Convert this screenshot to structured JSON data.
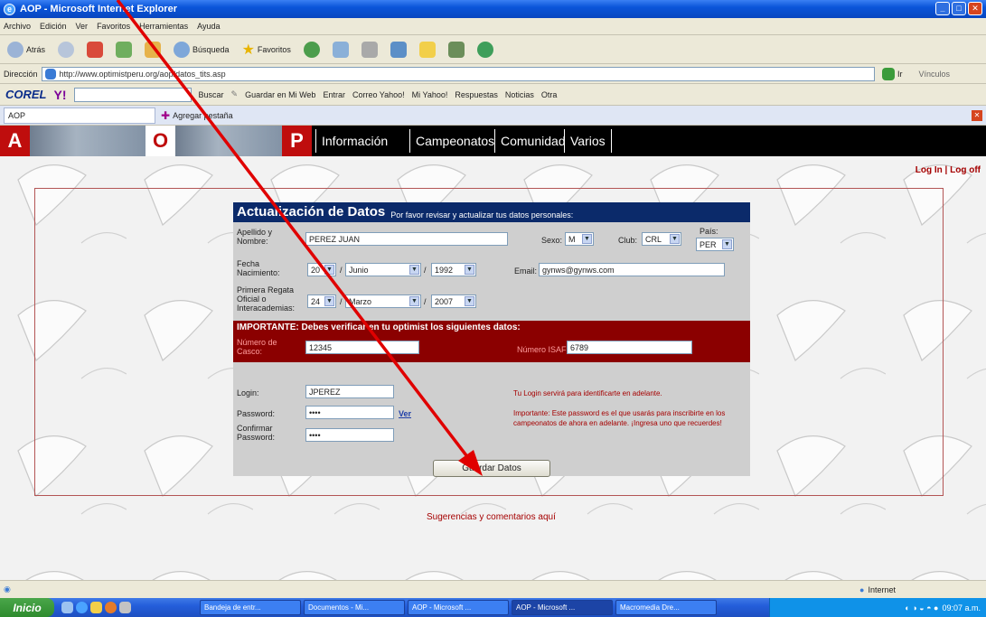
{
  "window": {
    "title": "AOP - Microsoft Internet Explorer"
  },
  "menu": [
    "Archivo",
    "Edición",
    "Ver",
    "Favoritos",
    "Herramientas",
    "Ayuda"
  ],
  "toolbar": {
    "back": "Atrás",
    "search": "Búsqueda",
    "favorites": "Favoritos"
  },
  "address": {
    "label": "Dirección",
    "url": "http://www.optimistperu.org/aop/datos_tits.asp",
    "go": "Ir",
    "links": "Vínculos"
  },
  "corel": {
    "brand": "COREL",
    "yahoo": "Y!",
    "search_btn": "Buscar",
    "save_web": "Guardar en Mi Web",
    "enter": "Entrar",
    "mail": "Correo Yahoo!",
    "myyahoo": "Mi Yahoo!",
    "answers": "Respuestas",
    "news": "Noticias",
    "more": "Otra"
  },
  "tabs": {
    "current": "AOP",
    "new_tab": "Agregar pestaña"
  },
  "site": {
    "logo": [
      "A",
      "O",
      "P"
    ],
    "nav": [
      "Información",
      "Campeonatos",
      "Comunidad",
      "Varios"
    ],
    "login": "Log In | Log off"
  },
  "form": {
    "title": "Actualización de Datos",
    "subtitle": "Por favor revisar y actualizar tus datos personales:",
    "labels": {
      "name": "Apellido y Nombre:",
      "sex": "Sexo:",
      "club": "Club:",
      "country": "País:",
      "birth": "Fecha Nacimiento:",
      "email": "Email:",
      "first_regatta": "Primera Regata Oficial o Interacademias:",
      "hull": "Número de Casco:",
      "isaf": "Número ISAF:",
      "login": "Login:",
      "password": "Password:",
      "confirm": "Confirmar Password:"
    },
    "values": {
      "name": "PEREZ JUAN",
      "sex": "M",
      "club": "CRL",
      "country": "PER",
      "birth_day": "20",
      "birth_month": "Junio",
      "birth_year": "1992",
      "email": "gynws@gynws.com",
      "reg_day": "24",
      "reg_month": "Marzo",
      "reg_year": "2007",
      "hull": "12345",
      "isaf": "6789",
      "login": "JPEREZ",
      "password": "••••",
      "confirm": "••••"
    },
    "important": "IMPORTANTE: Debes verificar en tu optimist los siguientes datos:",
    "see": "Ver",
    "note_login": "Tu Login servirá para identificarte en adelante.",
    "note_password": "Importante: Este password es el que usarás para inscribirte en los campeonatos de ahora en adelante. ¡Ingresa uno que recuerdes!",
    "save": "Guardar Datos"
  },
  "suggestions": "Sugerencias y comentarios aquí",
  "status": {
    "zone": "Internet"
  },
  "taskbar": {
    "start": "Inicio",
    "tasks": [
      "Bandeja de entr...",
      "Documentos - Mi...",
      "AOP - Microsoft ...",
      "AOP - Microsoft ...",
      "Macromedia Dre..."
    ],
    "clock": "09:07 a.m."
  },
  "colors": {
    "annotation": "#e00000",
    "banner": "#000000",
    "logo_red": "#bf0d0d",
    "form_head": "#0b2a6a",
    "red_section": "#8b0000"
  }
}
